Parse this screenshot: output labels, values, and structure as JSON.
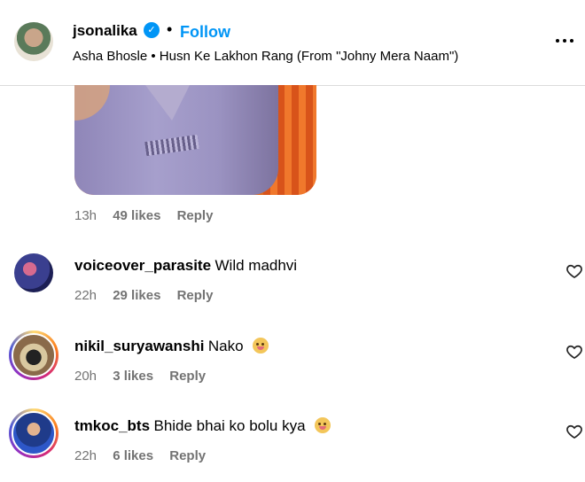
{
  "header": {
    "username": "jsonalika",
    "verified_glyph": "✓",
    "separator": "•",
    "follow_label": "Follow",
    "audio": "Asha Bhosle • Husn Ke Lakhon Rang (From \"Johny Mera Naam\")",
    "more_icon": "more-horizontal-icon"
  },
  "gif_comment": {
    "time": "13h",
    "likes": "49 likes",
    "reply_label": "Reply"
  },
  "comments": [
    {
      "username": "voiceover_parasite",
      "text": "Wild madhvi",
      "emoji": "",
      "time": "22h",
      "likes": "29 likes",
      "reply_label": "Reply"
    },
    {
      "username": "nikil_suryawanshi",
      "text": "Nako",
      "emoji": "face-with-tongue-emoji",
      "time": "20h",
      "likes": "3 likes",
      "reply_label": "Reply"
    },
    {
      "username": "tmkoc_bts",
      "text": "Bhide bhai ko bolu kya",
      "emoji": "face-with-tongue-emoji",
      "time": "22h",
      "likes": "6 likes",
      "reply_label": "Reply"
    }
  ],
  "colors": {
    "accent": "#0095f6",
    "secondary_text": "#737373",
    "divider": "#dbdbdb"
  }
}
